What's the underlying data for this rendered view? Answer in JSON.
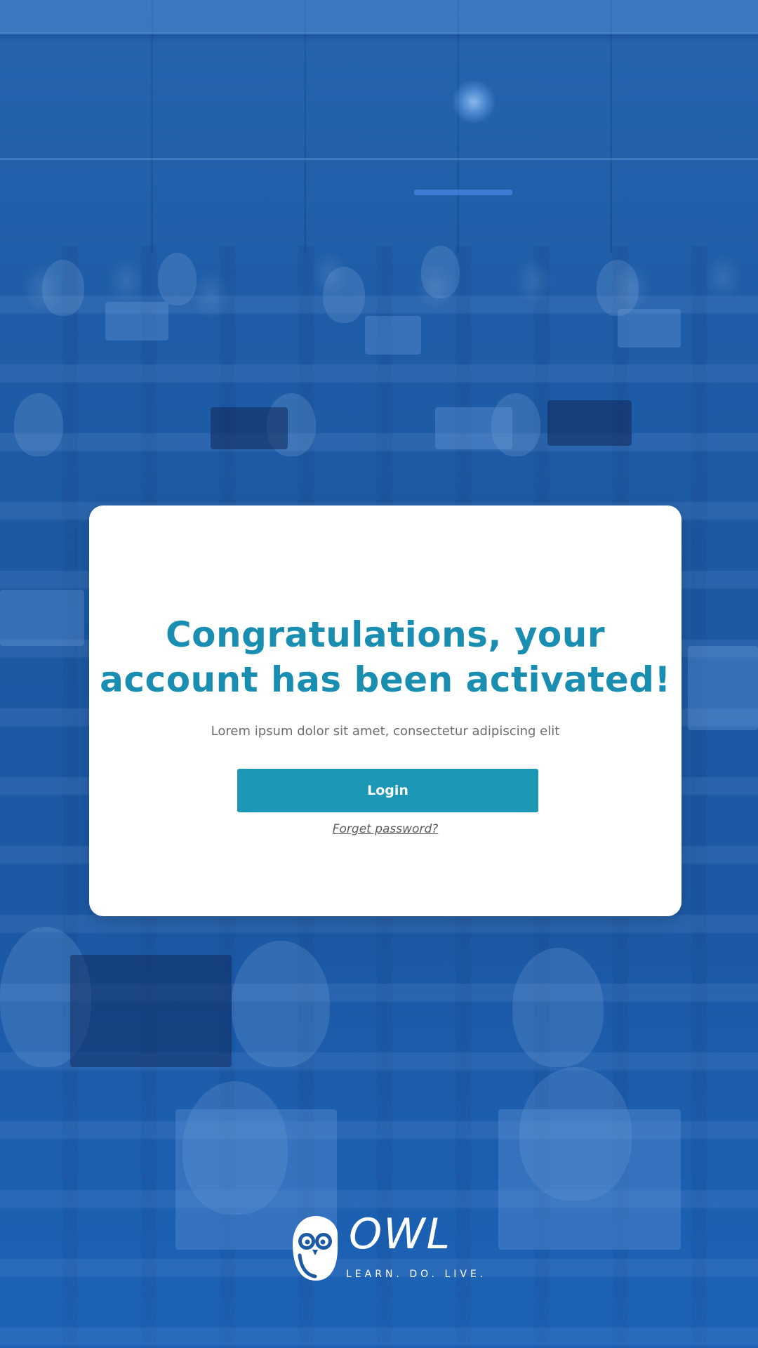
{
  "colors": {
    "accent": "#1a8eb0",
    "button": "#1c97b5",
    "background_tint": "#1c5a9e",
    "card": "#ffffff"
  },
  "card": {
    "title": "Congratulations, your account has been activated!",
    "subtitle": "Lorem ipsum dolor sit amet, consectetur adipiscing elit",
    "login_label": "Login",
    "forgot_label": "Forget password?"
  },
  "brand": {
    "name": "OWL",
    "tagline": "LEARN. DO. LIVE.",
    "icon": "owl-icon"
  },
  "background": {
    "icon": "lecture-hall-photo"
  }
}
